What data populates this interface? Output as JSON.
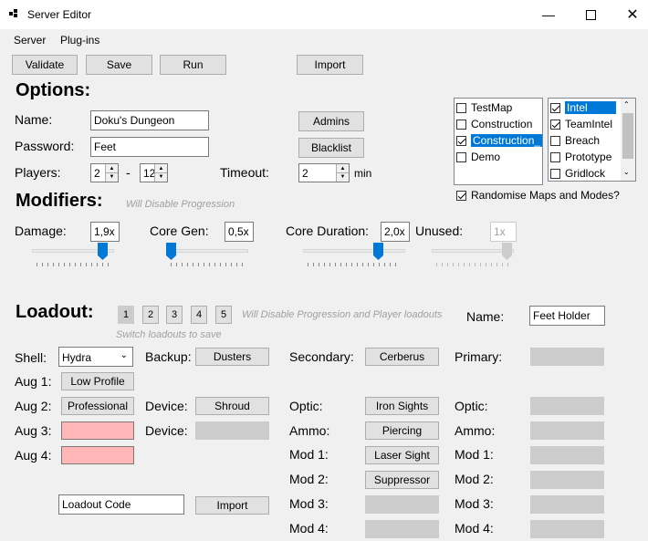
{
  "window": {
    "title": "Server Editor"
  },
  "menu": {
    "server": "Server",
    "plugins": "Plug-ins"
  },
  "toolbar": {
    "validate": "Validate",
    "save": "Save",
    "run": "Run",
    "import": "Import"
  },
  "options": {
    "heading": "Options:",
    "name_label": "Name:",
    "name_value": "Doku's Dungeon",
    "password_label": "Password:",
    "password_value": "Feet",
    "players_label": "Players:",
    "players_min": "2",
    "players_dash": "-",
    "players_max": "12",
    "timeout_label": "Timeout:",
    "timeout_value": "2",
    "timeout_unit": "min",
    "admins": "Admins",
    "blacklist": "Blacklist"
  },
  "maps": [
    {
      "label": "TestMap",
      "checked": false,
      "selected": false
    },
    {
      "label": "Construction",
      "checked": false,
      "selected": false
    },
    {
      "label": "Construction_",
      "checked": true,
      "selected": true
    },
    {
      "label": "Demo",
      "checked": false,
      "selected": false
    }
  ],
  "modes": [
    {
      "label": "Intel",
      "checked": true,
      "selected": true
    },
    {
      "label": "TeamIntel",
      "checked": true,
      "selected": false
    },
    {
      "label": "Breach",
      "checked": false,
      "selected": false
    },
    {
      "label": "Prototype",
      "checked": false,
      "selected": false
    },
    {
      "label": "Gridlock",
      "checked": false,
      "selected": false
    }
  ],
  "randomise": {
    "label": "Randomise Maps and Modes?",
    "checked": true
  },
  "modifiers": {
    "heading": "Modifiers:",
    "hint": "Will Disable Progression",
    "damage_label": "Damage:",
    "damage_value": "1,9x",
    "coregen_label": "Core Gen:",
    "coregen_value": "0,5x",
    "coreduration_label": "Core Duration:",
    "coreduration_value": "2,0x",
    "unused_label": "Unused:",
    "unused_value": "1x"
  },
  "loadout": {
    "heading": "Loadout:",
    "slots": [
      "1",
      "2",
      "3",
      "4",
      "5"
    ],
    "hint": "Will Disable Progression and Player loadouts",
    "switch_hint": "Switch loadouts  to save",
    "name_label": "Name:",
    "name_value": "Feet Holder",
    "shell_label": "Shell:",
    "shell_value": "Hydra",
    "backup_label": "Backup:",
    "backup_value": "Dusters",
    "aug1_label": "Aug 1:",
    "aug1_value": "Low Profile",
    "aug2_label": "Aug 2:",
    "aug2_value": "Professional",
    "aug3_label": "Aug 3:",
    "aug4_label": "Aug 4:",
    "device_label": "Device:",
    "device1_value": "Shroud",
    "device2_label": "Device:",
    "code_value": "Loadout Code",
    "import": "Import",
    "secondary_label": "Secondary:",
    "secondary_value": "Cerberus",
    "optic_label": "Optic:",
    "optic_value": "Iron Sights",
    "ammo_label": "Ammo:",
    "ammo_value": "Piercing",
    "mod1_label": "Mod 1:",
    "mod1_value": "Laser Sight",
    "mod2_label": "Mod 2:",
    "mod2_value": "Suppressor",
    "mod3_label": "Mod 3:",
    "mod4_label": "Mod 4:",
    "primary_label": "Primary:",
    "p_optic_label": "Optic:",
    "p_ammo_label": "Ammo:",
    "p_mod1_label": "Mod 1:",
    "p_mod2_label": "Mod 2:",
    "p_mod3_label": "Mod 3:",
    "p_mod4_label": "Mod 4:"
  },
  "colors": {
    "accent": "#0078d7",
    "pink": "#ffb6b6",
    "disabled": "#cccccc"
  }
}
